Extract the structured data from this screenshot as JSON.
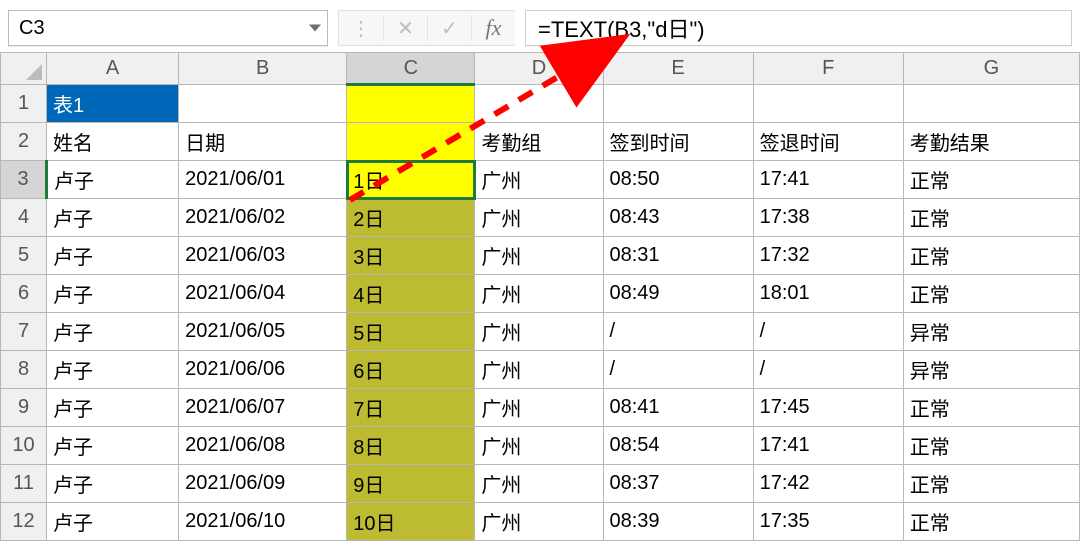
{
  "formula_bar": {
    "cell_ref": "C3",
    "formula": "=TEXT(B3,\"d日\")"
  },
  "col_headers": [
    "A",
    "B",
    "C",
    "D",
    "E",
    "F",
    "G"
  ],
  "row_headers": [
    "1",
    "2",
    "3",
    "4",
    "5",
    "6",
    "7",
    "8",
    "9",
    "10",
    "11",
    "12"
  ],
  "table_title": "表1",
  "headers": {
    "name": "姓名",
    "date": "日期",
    "blank": "",
    "group": "考勤组",
    "checkin": "签到时间",
    "checkout": "签退时间",
    "result": "考勤结果"
  },
  "rows": [
    {
      "name": "卢子",
      "date": "2021/06/01",
      "day": "1日",
      "group": "广州",
      "in": "08:50",
      "out": "17:41",
      "res": "正常"
    },
    {
      "name": "卢子",
      "date": "2021/06/02",
      "day": "2日",
      "group": "广州",
      "in": "08:43",
      "out": "17:38",
      "res": "正常"
    },
    {
      "name": "卢子",
      "date": "2021/06/03",
      "day": "3日",
      "group": "广州",
      "in": "08:31",
      "out": "17:32",
      "res": "正常"
    },
    {
      "name": "卢子",
      "date": "2021/06/04",
      "day": "4日",
      "group": "广州",
      "in": "08:49",
      "out": "18:01",
      "res": "正常"
    },
    {
      "name": "卢子",
      "date": "2021/06/05",
      "day": "5日",
      "group": "广州",
      "in": "/",
      "out": "/",
      "res": "异常"
    },
    {
      "name": "卢子",
      "date": "2021/06/06",
      "day": "6日",
      "group": "广州",
      "in": "/",
      "out": "/",
      "res": "异常"
    },
    {
      "name": "卢子",
      "date": "2021/06/07",
      "day": "7日",
      "group": "广州",
      "in": "08:41",
      "out": "17:45",
      "res": "正常"
    },
    {
      "name": "卢子",
      "date": "2021/06/08",
      "day": "8日",
      "group": "广州",
      "in": "08:54",
      "out": "17:41",
      "res": "正常"
    },
    {
      "name": "卢子",
      "date": "2021/06/09",
      "day": "9日",
      "group": "广州",
      "in": "08:37",
      "out": "17:42",
      "res": "正常"
    },
    {
      "name": "卢子",
      "date": "2021/06/10",
      "day": "10日",
      "group": "广州",
      "in": "08:39",
      "out": "17:35",
      "res": "正常"
    }
  ],
  "active_cell": "C3",
  "highlight_range": "C1:C12"
}
